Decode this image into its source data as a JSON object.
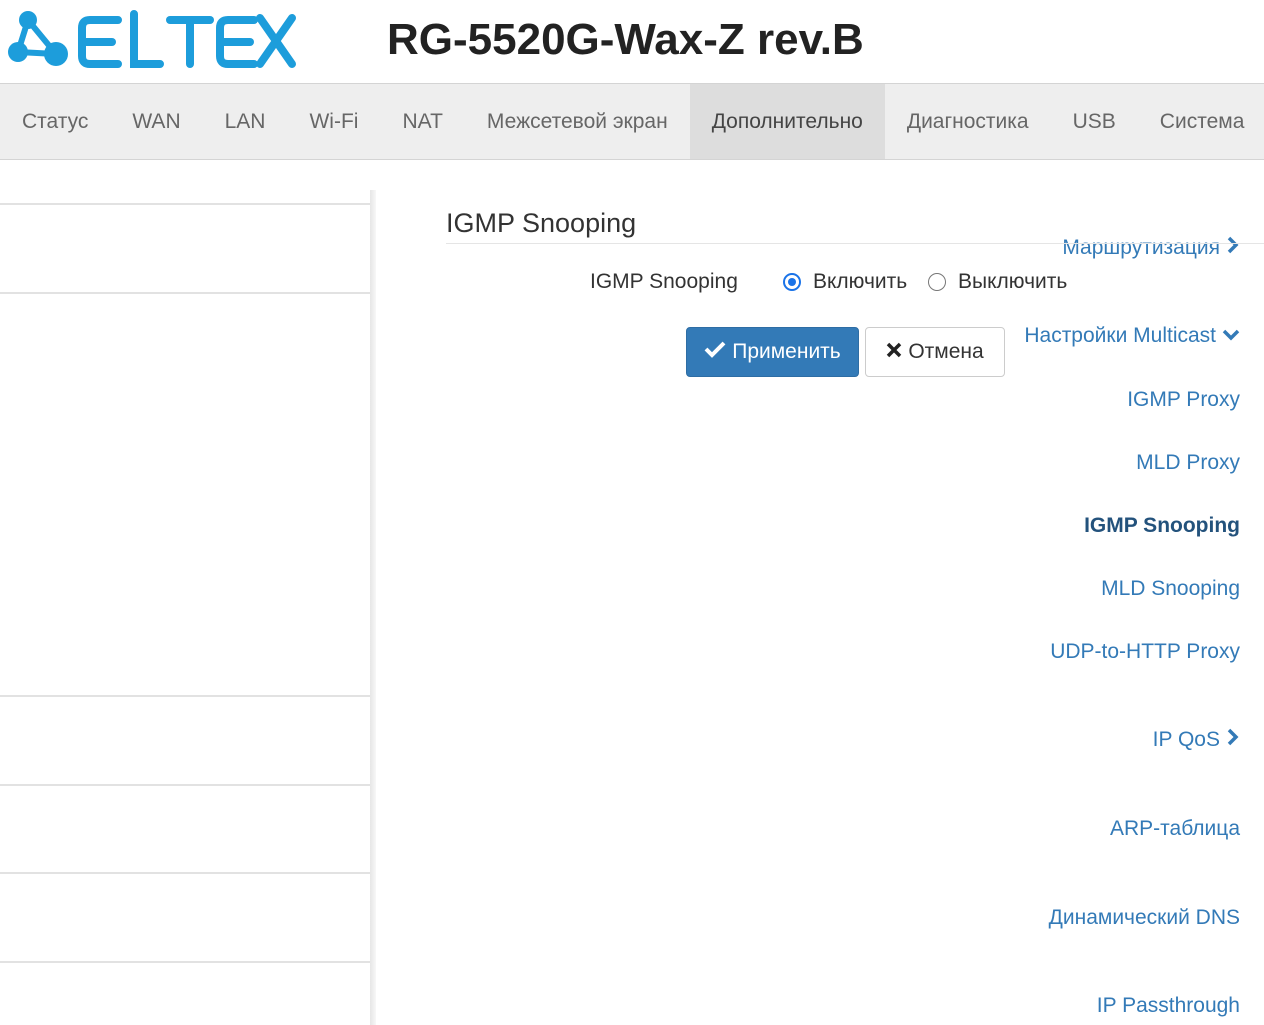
{
  "header": {
    "logo_text": "ELTEX",
    "device_title": "RG-5520G-Wax-Z rev.B"
  },
  "topnav": {
    "tabs": [
      {
        "label": "Статус"
      },
      {
        "label": "WAN"
      },
      {
        "label": "LAN"
      },
      {
        "label": "Wi-Fi"
      },
      {
        "label": "NAT"
      },
      {
        "label": "Межсетевой экран"
      },
      {
        "label": "Дополнительно",
        "active": true
      },
      {
        "label": "Диагностика"
      },
      {
        "label": "USB"
      },
      {
        "label": "Система"
      }
    ]
  },
  "sidebar": {
    "routing": {
      "label": "Маршрутизация",
      "icon": "chevron-right-icon"
    },
    "multicast": {
      "label": "Настройки Multicast",
      "icon": "chevron-down-icon"
    },
    "igmp_proxy": {
      "label": "IGMP Proxy"
    },
    "mld_proxy": {
      "label": "MLD Proxy"
    },
    "igmp_snooping": {
      "label": "IGMP Snooping",
      "active": true
    },
    "mld_snooping": {
      "label": "MLD Snooping"
    },
    "udp_http": {
      "label": "UDP-to-HTTP Proxy"
    },
    "ip_qos": {
      "label": "IP QoS",
      "icon": "chevron-right-icon"
    },
    "arp": {
      "label": "ARP-таблица"
    },
    "ddns": {
      "label": "Динамический DNS"
    },
    "ip_passthrough": {
      "label": "IP Passthrough"
    }
  },
  "main": {
    "section_title": "IGMP Snooping",
    "field_label": "IGMP Snooping",
    "option_enable": "Включить",
    "option_disable": "Выключить",
    "selected": "enable",
    "apply_label": "Применить",
    "cancel_label": "Отмена"
  },
  "colors": {
    "brand": "#1d9ddb",
    "link": "#337ab7",
    "primary_button": "#337ab7"
  }
}
